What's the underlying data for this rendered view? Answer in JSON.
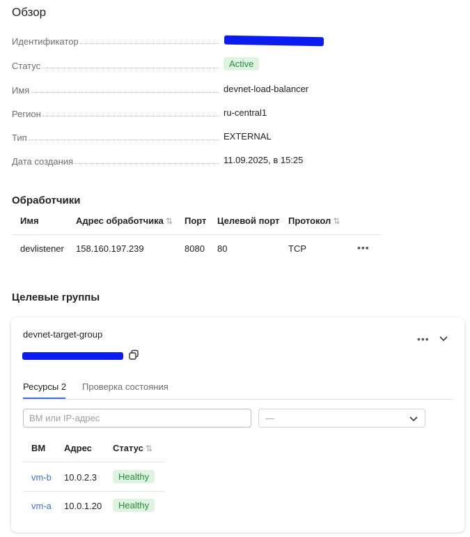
{
  "overview": {
    "title": "Обзор",
    "rows": [
      {
        "label": "Идентификатор",
        "value": ""
      },
      {
        "label": "Статус",
        "value": "Active"
      },
      {
        "label": "Имя",
        "value": "devnet-load-balancer"
      },
      {
        "label": "Регион",
        "value": "ru-central1"
      },
      {
        "label": "Тип",
        "value": "EXTERNAL"
      },
      {
        "label": "Дата создания",
        "value": "11.09.2025, в 15:25"
      }
    ]
  },
  "listeners": {
    "title": "Обработчики",
    "columns": [
      "Имя",
      "Адрес обработчика",
      "Порт",
      "Целевой порт",
      "Протокол"
    ],
    "sort_icon": "⇅",
    "rows": [
      {
        "name": "devlistener",
        "address": "158.160.197.239",
        "port": "8080",
        "target_port": "80",
        "protocol": "TCP"
      }
    ]
  },
  "target_groups": {
    "title": "Целевые группы",
    "group": {
      "name": "devnet-target-group",
      "tabs": [
        {
          "label": "Ресурсы 2",
          "active": true
        },
        {
          "label": "Проверка состояния",
          "active": false
        }
      ],
      "search_placeholder": "ВМ или IP-адрес",
      "filter_value": "—",
      "columns": [
        "ВМ",
        "Адрес",
        "Статус"
      ],
      "rows": [
        {
          "vm": "vm-b",
          "address": "10.0.2.3",
          "status": "Healthy"
        },
        {
          "vm": "vm-a",
          "address": "10.0.1.20",
          "status": "Healthy"
        }
      ]
    }
  },
  "colors": {
    "accent": "#3a6fd8",
    "success_bg": "#dff3e1",
    "success_text": "#2b8a3e",
    "redaction": "#0a1cf0"
  }
}
